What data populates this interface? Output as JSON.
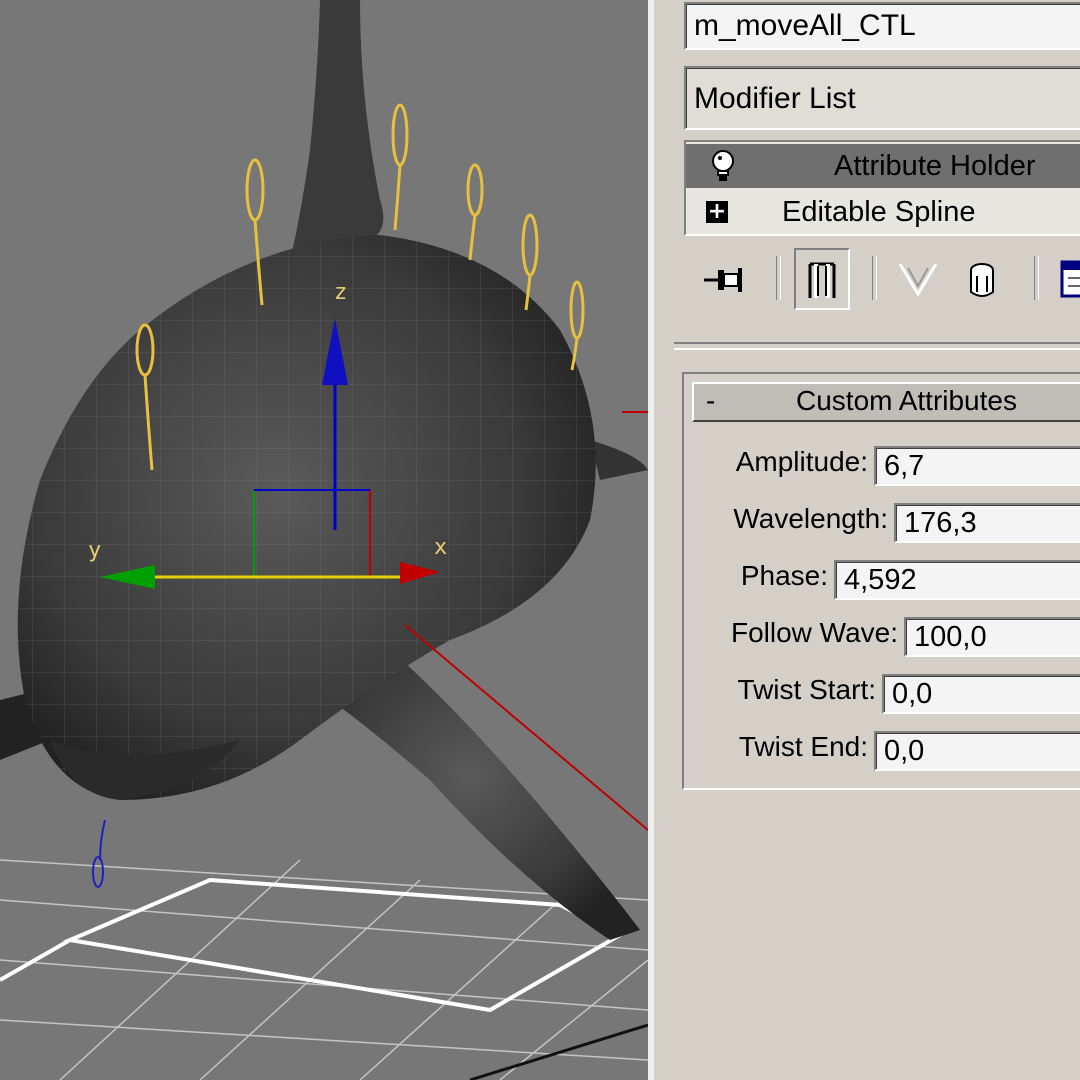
{
  "panel": {
    "object_name": "m_moveAll_CTL",
    "modifier_list_label": "Modifier List",
    "stack": [
      {
        "label": "Attribute Holder",
        "icon": "lightbulb-icon",
        "selected": true
      },
      {
        "label": "Editable Spline",
        "icon": "expand-plus-icon",
        "expander": "+",
        "selected": false
      }
    ],
    "toolbar": [
      {
        "icon": "pin-stack-icon"
      },
      {
        "icon": "show-end-result-icon",
        "active": true
      },
      {
        "icon": "make-unique-icon"
      },
      {
        "icon": "remove-modifier-icon"
      },
      {
        "icon": "configure-modifier-sets-icon"
      }
    ],
    "rollout": {
      "toggle": "-",
      "title": "Custom Attributes",
      "attributes": [
        {
          "label": "Amplitude:",
          "value": "6,7"
        },
        {
          "label": "Wavelength:",
          "value": "176,3"
        },
        {
          "label": "Phase:",
          "value": "4,592"
        },
        {
          "label": "Follow Wave:",
          "value": "100,0"
        },
        {
          "label": "Twist Start:",
          "value": "0,0"
        },
        {
          "label": "Twist End:",
          "value": "0,0"
        }
      ]
    }
  },
  "viewport": {
    "gizmo_labels": {
      "x": "x",
      "y": "y",
      "z": "z"
    },
    "colors": {
      "x_axis": "#c00000",
      "y_axis": "#008000",
      "z_axis": "#0000c8",
      "control_curves": "#e8c040",
      "selection": "#ffffff"
    }
  }
}
